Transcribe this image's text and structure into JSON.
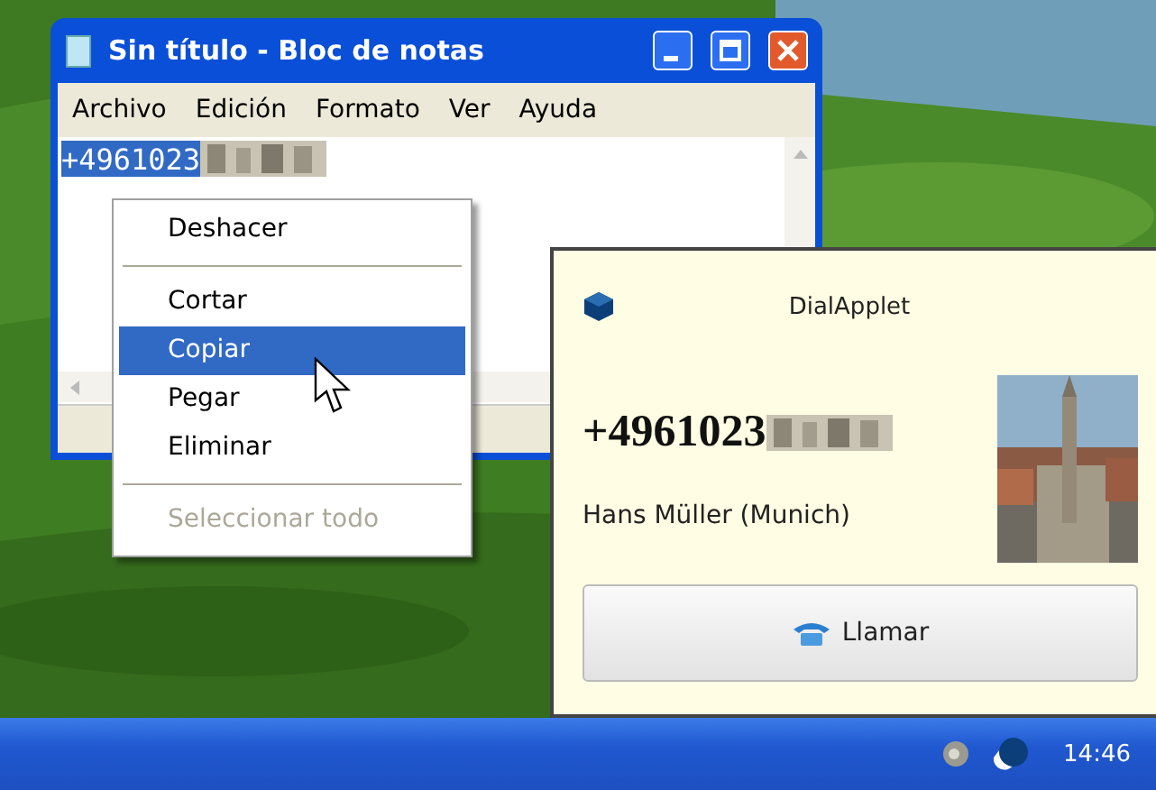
{
  "notepad": {
    "title": "Sin título - Bloc de notas",
    "menu": [
      "Archivo",
      "Edición",
      "Formato",
      "Ver",
      "Ayuda"
    ],
    "text": "+4961023"
  },
  "context_menu": {
    "items": [
      {
        "kind": "item",
        "label": "Deshacer",
        "selected": false,
        "disabled": false
      },
      {
        "kind": "separator"
      },
      {
        "kind": "item",
        "label": "Cortar",
        "selected": false,
        "disabled": false
      },
      {
        "kind": "item",
        "label": "Copiar",
        "selected": true,
        "disabled": false
      },
      {
        "kind": "item",
        "label": "Pegar",
        "selected": false,
        "disabled": false
      },
      {
        "kind": "item",
        "label": "Eliminar",
        "selected": false,
        "disabled": false
      },
      {
        "kind": "separator"
      },
      {
        "kind": "item",
        "label": "Seleccionar todo",
        "selected": false,
        "disabled": true
      }
    ]
  },
  "dial_applet": {
    "title": "DialApplet",
    "number": "+4961023",
    "contact": "Hans Müller (Munich)",
    "call_button": "Llamar"
  },
  "taskbar": {
    "clock": "14:46"
  }
}
